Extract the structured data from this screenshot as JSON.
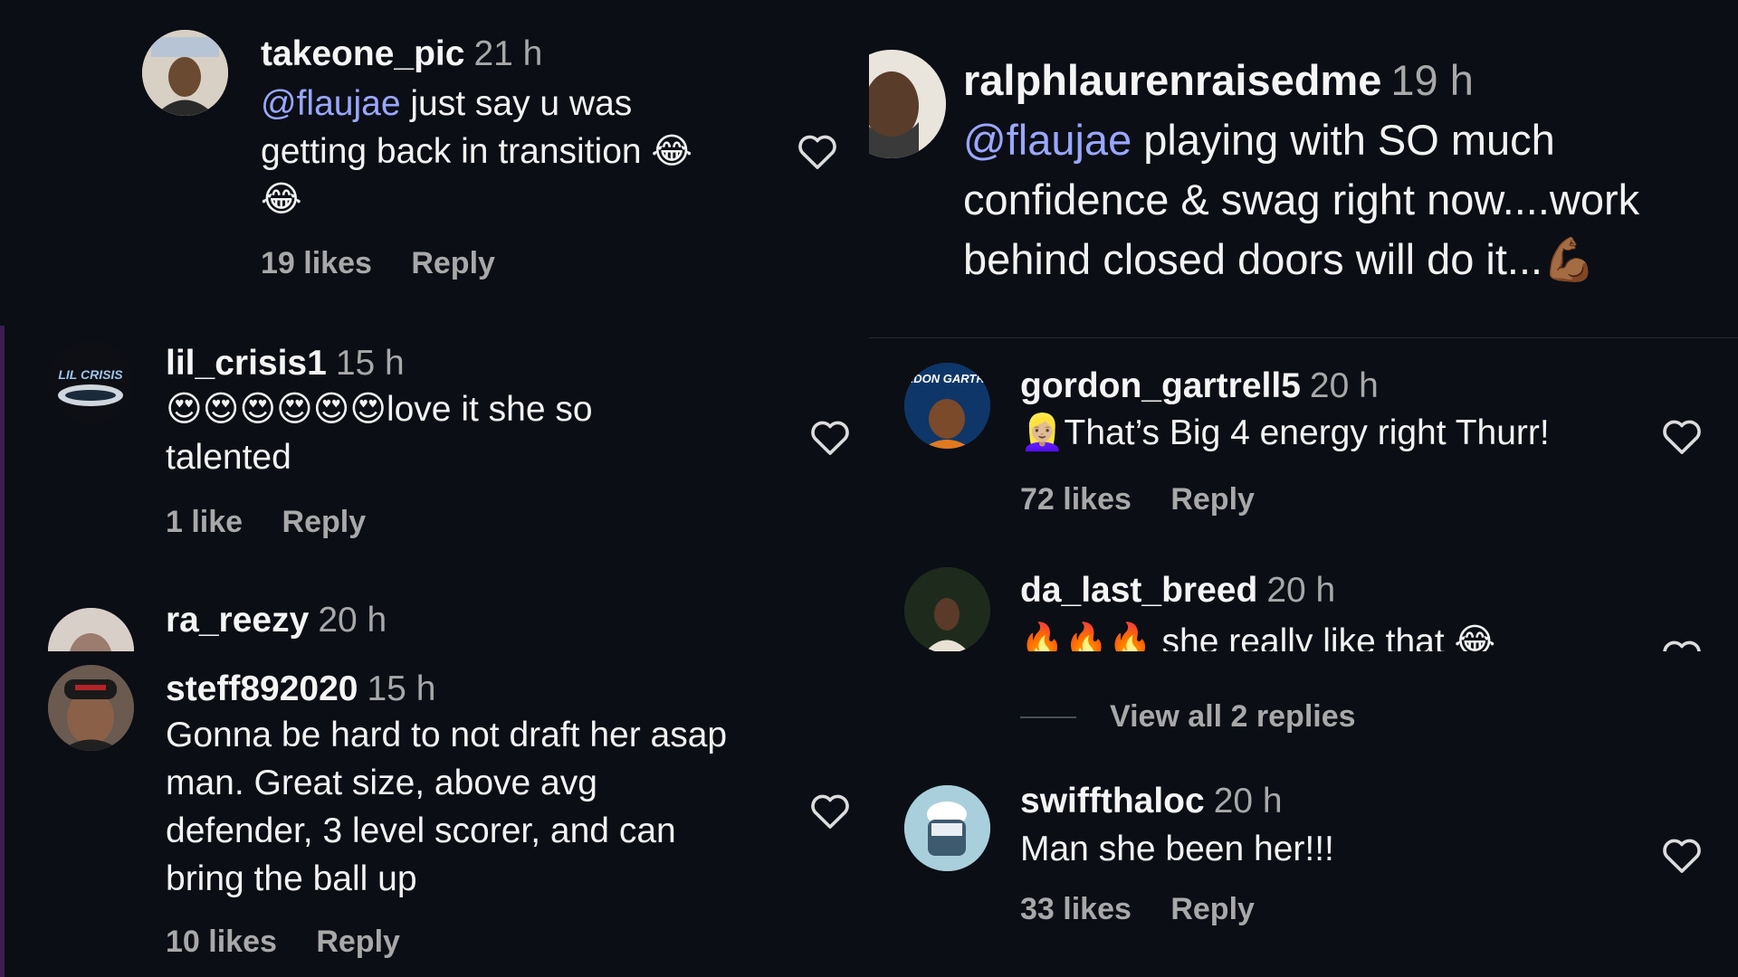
{
  "colors": {
    "background": "#0b0e15",
    "mention": "#9aa7ff",
    "muted": "#a8a8a8",
    "heart_outline": "#dcdcdc"
  },
  "left_top": {
    "comment": {
      "username": "takeone_pic",
      "time": "21 h",
      "mention": "@flaujae",
      "text_line1": " just say u was",
      "text_line2": "getting back in transition 😂",
      "text_line3": "😂",
      "likes": "19 likes",
      "reply": "Reply"
    }
  },
  "left_mid": {
    "comments": [
      {
        "username": "lil_crisis1",
        "time": "15 h",
        "text_line1": "😍😍😍😍😍😍love it she so",
        "text_line2": "talented",
        "likes": "1 like",
        "reply": "Reply"
      },
      {
        "username": "ra_reezy",
        "time": "20 h"
      }
    ]
  },
  "left_bottom": {
    "comment": {
      "username": "steff892020",
      "time": "15 h",
      "text_line1": "Gonna be hard to not draft her asap",
      "text_line2": "man. Great size, above avg",
      "text_line3": "defender, 3 level scorer, and can",
      "text_line4": "bring the ball up",
      "likes": "10 likes",
      "reply": "Reply"
    }
  },
  "right_top": {
    "comment": {
      "username": "ralphlaurenraisedme",
      "time": "19 h",
      "mention": "@flaujae",
      "text_line1": " playing with SO much",
      "text_line2": "confidence & swag right now....work",
      "text_line3": "behind closed doors will do it...💪🏾"
    }
  },
  "right_mid": {
    "comments": [
      {
        "username": "gordon_gartrell5",
        "time": "20 h",
        "text": "👱🏼‍♀️That’s Big 4 energy right Thurr!",
        "likes": "72 likes",
        "reply": "Reply",
        "avatar_text": "GORDON GARTRELL"
      },
      {
        "username": "da_last_breed",
        "time": "20 h",
        "text_partial": "🔥🔥🔥 she really like that 😂"
      }
    ]
  },
  "right_bottom": {
    "view_replies": "View all 2 replies",
    "comment": {
      "username": "swiffthaloc",
      "time": "20 h",
      "text": "Man she been her!!!",
      "likes": "33 likes",
      "reply": "Reply"
    }
  },
  "icons": {
    "like": "heart-outline-icon"
  },
  "avatars": {
    "lil_crisis1_text": "LIL CRISIS"
  }
}
